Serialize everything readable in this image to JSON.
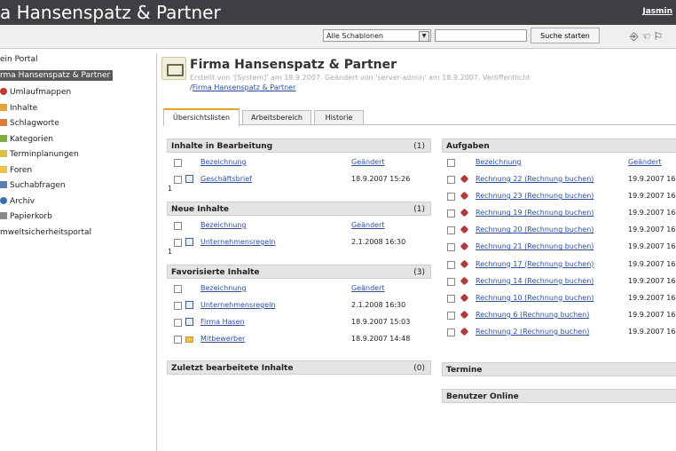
{
  "header": {
    "title": "a Hansenspatz & Partner",
    "user": "Jasmin"
  },
  "toolbar": {
    "template_select": "Alle Schablonen",
    "search_button": "Suche starten",
    "icons": [
      "door-icon",
      "hand-icon",
      "flag-icon"
    ]
  },
  "sidebar": {
    "root": "ein Portal",
    "selected": "rma Hansenspatz & Partner",
    "items": [
      {
        "label": "Umlaufmappen",
        "icon": "circle-arrow-icon",
        "color": "#c0392b"
      },
      {
        "label": "Inhalte",
        "icon": "page-icon",
        "color": "#e8a23a"
      },
      {
        "label": "Schlagworte",
        "icon": "tag-icon",
        "color": "#e07b39"
      },
      {
        "label": "Kategorien",
        "icon": "category-icon",
        "color": "#7fae3f"
      },
      {
        "label": "Terminplanungen",
        "icon": "calendar-icon",
        "color": "#d8c040"
      },
      {
        "label": "Foren",
        "icon": "forum-icon",
        "color": "#f0c24b"
      },
      {
        "label": "Suchabfragen",
        "icon": "search-icon",
        "color": "#5a7fb8"
      },
      {
        "label": "Archiv",
        "icon": "globe-icon",
        "color": "#3a6fb0"
      },
      {
        "label": "Papierkorb",
        "icon": "trash-icon",
        "color": "#888888"
      },
      {
        "label": "mweltsicherheitsportal",
        "icon": "",
        "color": ""
      }
    ]
  },
  "page": {
    "title": "Firma Hansenspatz & Partner",
    "meta": "Erstellt von '[System]' am 18.9.2007. Geändert von 'server-admin' am 18.9.2007. Veröffentlicht",
    "breadcrumb_sep": "/",
    "breadcrumb": "Firma Hansenspatz & Partner"
  },
  "tabs": [
    "Übersichtslisten",
    "Arbeitsbereich",
    "Historie"
  ],
  "columns": {
    "name": "Bezeichnung",
    "changed": "Geändert"
  },
  "left_panels": [
    {
      "title": "Inhalte in Bearbeitung",
      "count": "(1)",
      "footer": "1",
      "rows": [
        {
          "name": "Geschäftsbrief",
          "date": "18.9.2007 15:26",
          "icon": "doc"
        }
      ]
    },
    {
      "title": "Neue Inhalte",
      "count": "(1)",
      "footer": "1",
      "rows": [
        {
          "name": "Unternehmensregeln",
          "date": "2.1.2008 16:30",
          "icon": "doc"
        }
      ]
    },
    {
      "title": "Favorisierte Inhalte",
      "count": "(3)",
      "footer": "",
      "rows": [
        {
          "name": "Unternehmensregeln",
          "date": "2.1.2008 16:30",
          "icon": "doc"
        },
        {
          "name": "Firma Hasen",
          "date": "18.9.2007 15:03",
          "icon": "doc"
        },
        {
          "name": "Mitbewerber",
          "date": "18.9.2007 14:48",
          "icon": "folder"
        }
      ]
    },
    {
      "title": "Zuletzt bearbeitete Inhalte",
      "count": "(0)",
      "footer": "",
      "rows": []
    }
  ],
  "tasks": {
    "title": "Aufgaben",
    "rows": [
      {
        "name": "Rechnung 22 (Rechnung buchen)",
        "date": "19.9.2007 16"
      },
      {
        "name": "Rechnung 23 (Rechnung buchen)",
        "date": "19.9.2007 16"
      },
      {
        "name": "Rechnung 19 (Rechnung buchen)",
        "date": "19.9.2007 16"
      },
      {
        "name": "Rechnung 20 (Rechnung buchen)",
        "date": "19.9.2007 16"
      },
      {
        "name": "Rechnung 21 (Rechnung buchen)",
        "date": "19.9.2007 16"
      },
      {
        "name": "Rechnung 17 (Rechnung buchen)",
        "date": "19.9.2007 16"
      },
      {
        "name": "Rechnung 14 (Rechnung buchen)",
        "date": "19.9.2007 16"
      },
      {
        "name": "Rechnung 10 (Rechnung buchen)",
        "date": "19.9.2007 16"
      },
      {
        "name": "Rechnung 6 (Rechnung buchen)",
        "date": "19.9.2007 16"
      },
      {
        "name": "Rechnung 2 (Rechnung buchen)",
        "date": "19.9.2007 16"
      }
    ]
  },
  "right_panels": [
    {
      "title": "Termine"
    },
    {
      "title": "Benutzer Online"
    }
  ]
}
